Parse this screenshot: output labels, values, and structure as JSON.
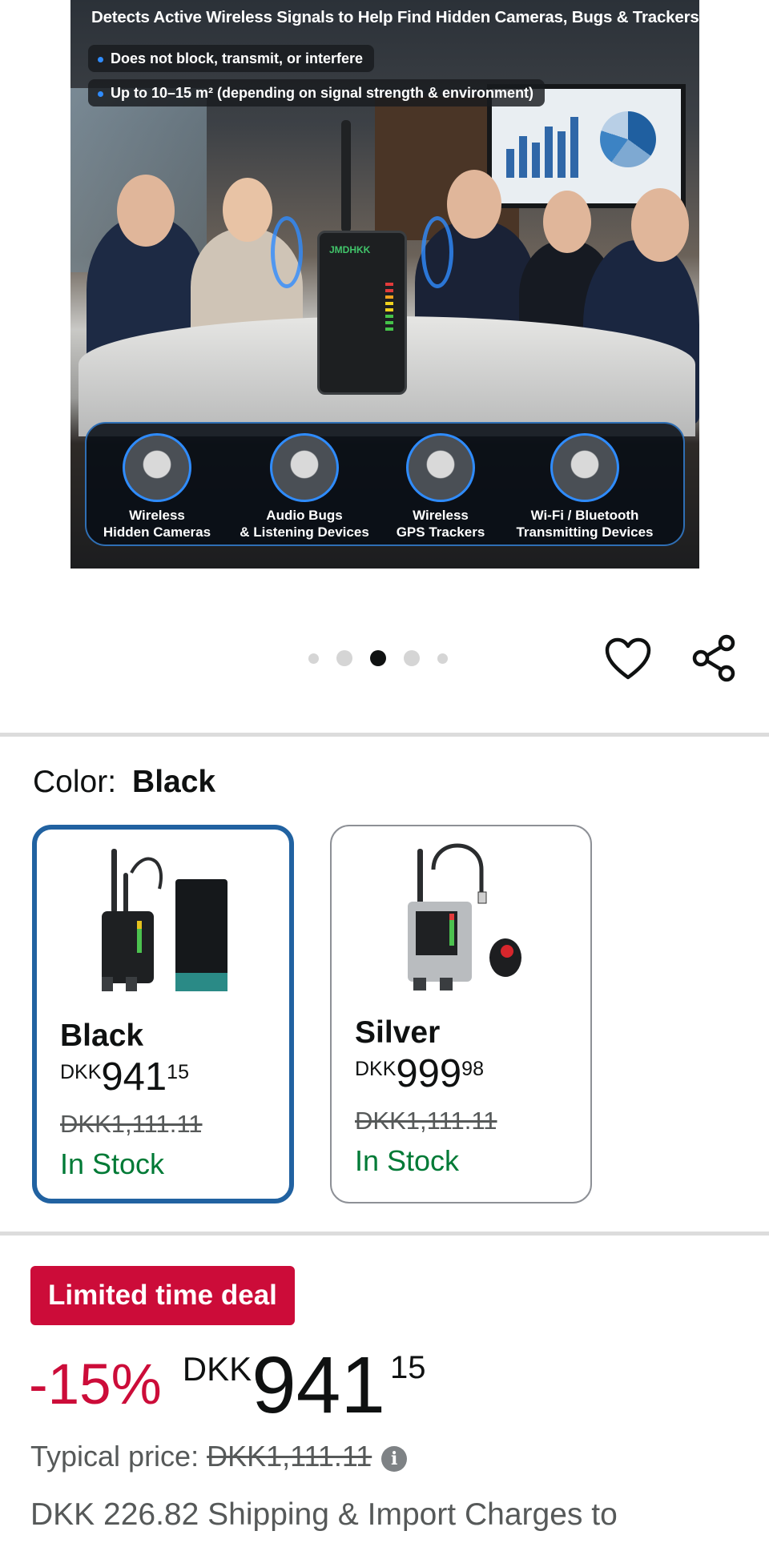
{
  "hero": {
    "headline": "Detects Active Wireless Signals to Help Find Hidden Cameras, Bugs & Trackers",
    "bullets": [
      "Does not block, transmit, or interfere",
      "Up to 10–15 m² (depending on signal strength & environment)"
    ],
    "device_brand": "JMDHKK",
    "features": [
      {
        "line1": "Wireless",
        "line2": "Hidden Cameras"
      },
      {
        "line1": "Audio Bugs",
        "line2": "& Listening Devices"
      },
      {
        "line1": "Wireless",
        "line2": "GPS Trackers"
      },
      {
        "line1": "Wi-Fi / Bluetooth",
        "line2": "Transmitting Devices"
      }
    ]
  },
  "carousel": {
    "total": 5,
    "active_index": 2
  },
  "color": {
    "label": "Color:",
    "selected": "Black"
  },
  "variants": [
    {
      "name": "Black",
      "currency": "DKK",
      "whole": "941",
      "fraction": "15",
      "list_price": "DKK1,111.11",
      "stock": "In Stock",
      "selected": true
    },
    {
      "name": "Silver",
      "currency": "DKK",
      "whole": "999",
      "fraction": "98",
      "list_price": "DKK1,111.11",
      "stock": "In Stock",
      "selected": false
    }
  ],
  "deal": {
    "badge": "Limited time deal",
    "discount": "-15%",
    "currency": "DKK",
    "whole": "941",
    "fraction": "15",
    "typical_label": "Typical price:",
    "typical_price": "DKK1,111.11",
    "shipping": "DKK 226.82 Shipping & Import Charges to"
  },
  "icons": [
    "heart-icon",
    "share-icon",
    "info-icon"
  ],
  "colors": {
    "accent": "#2162a1",
    "deal": "#cc0c39",
    "stock": "#007a36",
    "muted": "#565959"
  }
}
